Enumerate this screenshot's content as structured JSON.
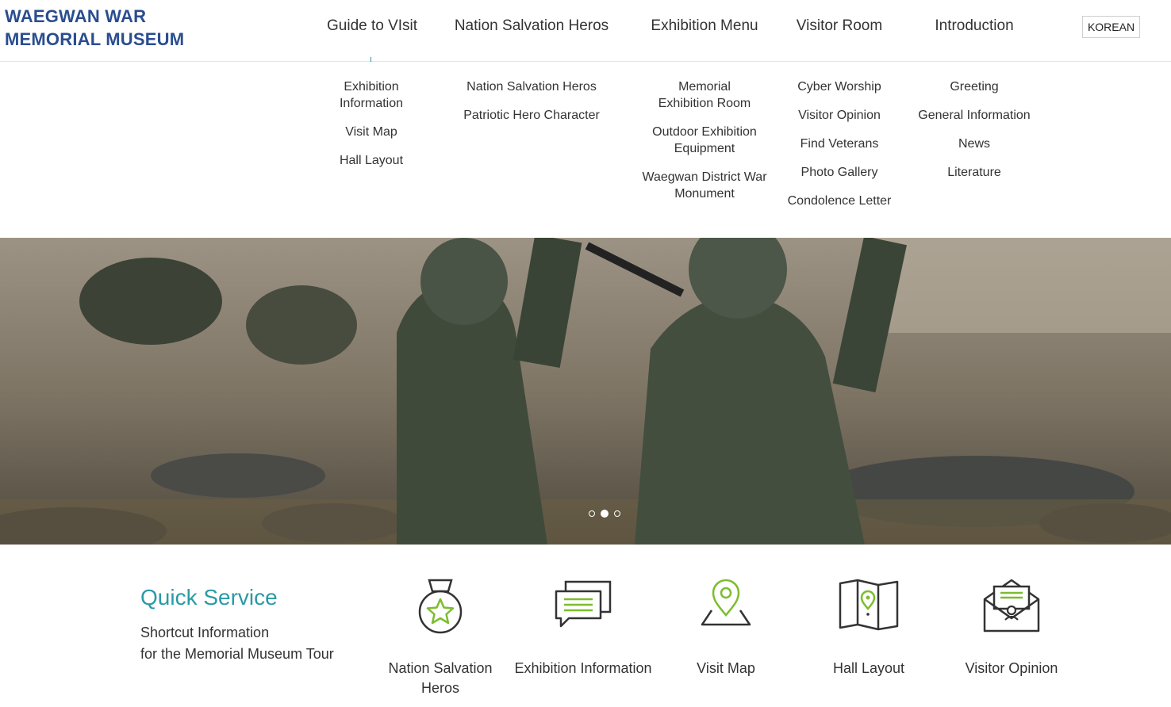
{
  "logo": {
    "line1": "WAEGWAN WAR",
    "line2": "MEMORIAL MUSEUM"
  },
  "nav": [
    {
      "label": "Guide to VIsit",
      "items": [
        "Exhibition Information",
        "Visit Map",
        "Hall Layout"
      ]
    },
    {
      "label": "Nation Salvation Heros",
      "items": [
        "Nation Salvation Heros",
        "Patriotic Hero Character"
      ]
    },
    {
      "label": "Exhibition Menu",
      "items": [
        "Memorial Exhibition Room",
        "Outdoor Exhibition Equipment",
        "Waegwan District War Monument"
      ]
    },
    {
      "label": "Visitor Room",
      "items": [
        "Cyber Worship",
        "Visitor Opinion",
        "Find Veterans",
        "Photo Gallery",
        "Condolence Letter"
      ]
    },
    {
      "label": "Introduction",
      "items": [
        "Greeting",
        "General Information",
        "News",
        "Literature"
      ]
    }
  ],
  "lang_button": "KOREAN",
  "slider": {
    "slide_count": 3,
    "active_index": 1
  },
  "quick_service": {
    "title": "Quick Service",
    "subtitle_line1": "Shortcut Information",
    "subtitle_line2": "for the Memorial Museum Tour",
    "items": [
      {
        "label": "Nation Salvation Heros",
        "icon": "medal-icon"
      },
      {
        "label": "Exhibition Information",
        "icon": "chat-bubbles-icon"
      },
      {
        "label": "Visit Map",
        "icon": "map-pin-icon"
      },
      {
        "label": "Hall Layout",
        "icon": "folded-map-icon"
      },
      {
        "label": "Visitor Opinion",
        "icon": "envelope-letter-icon"
      }
    ]
  },
  "colors": {
    "logo": "#2a4d8f",
    "accent_teal": "#2a9aa6",
    "icon_green": "#7cbd2e",
    "icon_dark": "#333333"
  }
}
